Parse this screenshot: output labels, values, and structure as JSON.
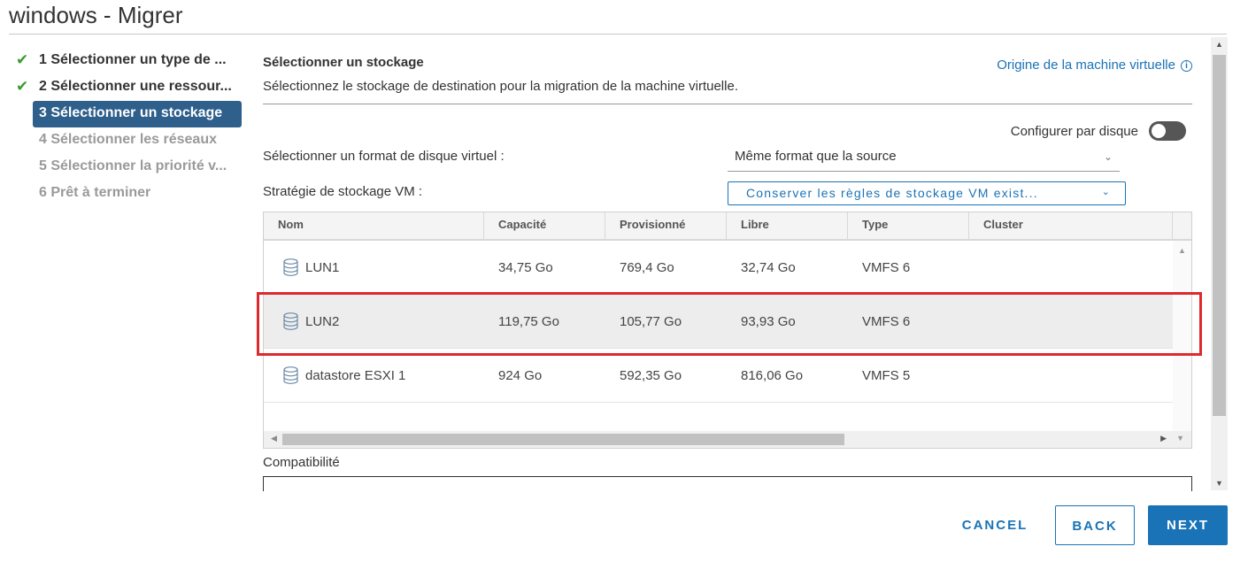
{
  "window": {
    "title": "windows - Migrer"
  },
  "steps": [
    {
      "label": "1 Sélectionner un type de ...",
      "state": "done"
    },
    {
      "label": "2 Sélectionner une ressour...",
      "state": "done"
    },
    {
      "label": "3 Sélectionner un stockage",
      "state": "active"
    },
    {
      "label": "4 Sélectionner les réseaux",
      "state": "pending"
    },
    {
      "label": "5 Sélectionner la priorité v...",
      "state": "pending"
    },
    {
      "label": "6 Prêt à terminer",
      "state": "pending"
    }
  ],
  "section": {
    "title": "Sélectionner un stockage",
    "description": "Sélectionnez le stockage de destination pour la migration de la machine virtuelle.",
    "origin_link": "Origine de la machine virtuelle"
  },
  "config_per_disk": {
    "label": "Configurer par disque",
    "enabled": false
  },
  "disk_format": {
    "label": "Sélectionner un format de disque virtuel :",
    "value": "Même format que la source"
  },
  "storage_policy": {
    "label": "Stratégie de stockage VM :",
    "value": "Conserver les règles de stockage VM exist..."
  },
  "grid": {
    "headers": [
      "Nom",
      "Capacité",
      "Provisionné",
      "Libre",
      "Type",
      "Cluster"
    ],
    "rows": [
      {
        "name": "LUN1",
        "capacity": "34,75 Go",
        "provisioned": "769,4 Go",
        "free": "32,74 Go",
        "type": "VMFS 6",
        "cluster": "",
        "selected": false
      },
      {
        "name": "LUN2",
        "capacity": "119,75 Go",
        "provisioned": "105,77 Go",
        "free": "93,93 Go",
        "type": "VMFS 6",
        "cluster": "",
        "selected": true
      },
      {
        "name": "datastore ESXI 1",
        "capacity": "924 Go",
        "provisioned": "592,35 Go",
        "free": "816,06 Go",
        "type": "VMFS 5",
        "cluster": "",
        "selected": false
      }
    ]
  },
  "compatibility": {
    "label": "Compatibilité"
  },
  "footer": {
    "cancel": "CANCEL",
    "back": "BACK",
    "next": "NEXT"
  },
  "colors": {
    "accent": "#1a73b6",
    "active_step": "#2f5f8b",
    "check": "#3a9b2f",
    "highlight": "#dd2a2e"
  }
}
